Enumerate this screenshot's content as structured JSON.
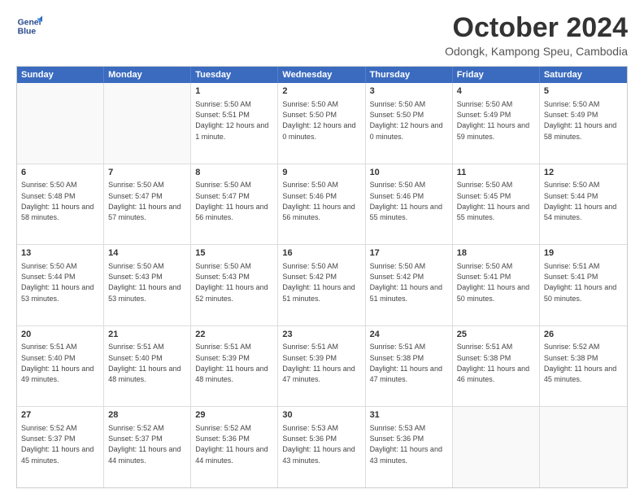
{
  "header": {
    "logo_line1": "General",
    "logo_line2": "Blue",
    "month_title": "October 2024",
    "location": "Odongk, Kampong Speu, Cambodia"
  },
  "days_of_week": [
    "Sunday",
    "Monday",
    "Tuesday",
    "Wednesday",
    "Thursday",
    "Friday",
    "Saturday"
  ],
  "weeks": [
    [
      {
        "day": "",
        "empty": true,
        "sunrise": "",
        "sunset": "",
        "daylight": ""
      },
      {
        "day": "",
        "empty": true,
        "sunrise": "",
        "sunset": "",
        "daylight": ""
      },
      {
        "day": "1",
        "sunrise": "Sunrise: 5:50 AM",
        "sunset": "Sunset: 5:51 PM",
        "daylight": "Daylight: 12 hours and 1 minute."
      },
      {
        "day": "2",
        "sunrise": "Sunrise: 5:50 AM",
        "sunset": "Sunset: 5:50 PM",
        "daylight": "Daylight: 12 hours and 0 minutes."
      },
      {
        "day": "3",
        "sunrise": "Sunrise: 5:50 AM",
        "sunset": "Sunset: 5:50 PM",
        "daylight": "Daylight: 12 hours and 0 minutes."
      },
      {
        "day": "4",
        "sunrise": "Sunrise: 5:50 AM",
        "sunset": "Sunset: 5:49 PM",
        "daylight": "Daylight: 11 hours and 59 minutes."
      },
      {
        "day": "5",
        "sunrise": "Sunrise: 5:50 AM",
        "sunset": "Sunset: 5:49 PM",
        "daylight": "Daylight: 11 hours and 58 minutes."
      }
    ],
    [
      {
        "day": "6",
        "sunrise": "Sunrise: 5:50 AM",
        "sunset": "Sunset: 5:48 PM",
        "daylight": "Daylight: 11 hours and 58 minutes."
      },
      {
        "day": "7",
        "sunrise": "Sunrise: 5:50 AM",
        "sunset": "Sunset: 5:47 PM",
        "daylight": "Daylight: 11 hours and 57 minutes."
      },
      {
        "day": "8",
        "sunrise": "Sunrise: 5:50 AM",
        "sunset": "Sunset: 5:47 PM",
        "daylight": "Daylight: 11 hours and 56 minutes."
      },
      {
        "day": "9",
        "sunrise": "Sunrise: 5:50 AM",
        "sunset": "Sunset: 5:46 PM",
        "daylight": "Daylight: 11 hours and 56 minutes."
      },
      {
        "day": "10",
        "sunrise": "Sunrise: 5:50 AM",
        "sunset": "Sunset: 5:46 PM",
        "daylight": "Daylight: 11 hours and 55 minutes."
      },
      {
        "day": "11",
        "sunrise": "Sunrise: 5:50 AM",
        "sunset": "Sunset: 5:45 PM",
        "daylight": "Daylight: 11 hours and 55 minutes."
      },
      {
        "day": "12",
        "sunrise": "Sunrise: 5:50 AM",
        "sunset": "Sunset: 5:44 PM",
        "daylight": "Daylight: 11 hours and 54 minutes."
      }
    ],
    [
      {
        "day": "13",
        "sunrise": "Sunrise: 5:50 AM",
        "sunset": "Sunset: 5:44 PM",
        "daylight": "Daylight: 11 hours and 53 minutes."
      },
      {
        "day": "14",
        "sunrise": "Sunrise: 5:50 AM",
        "sunset": "Sunset: 5:43 PM",
        "daylight": "Daylight: 11 hours and 53 minutes."
      },
      {
        "day": "15",
        "sunrise": "Sunrise: 5:50 AM",
        "sunset": "Sunset: 5:43 PM",
        "daylight": "Daylight: 11 hours and 52 minutes."
      },
      {
        "day": "16",
        "sunrise": "Sunrise: 5:50 AM",
        "sunset": "Sunset: 5:42 PM",
        "daylight": "Daylight: 11 hours and 51 minutes."
      },
      {
        "day": "17",
        "sunrise": "Sunrise: 5:50 AM",
        "sunset": "Sunset: 5:42 PM",
        "daylight": "Daylight: 11 hours and 51 minutes."
      },
      {
        "day": "18",
        "sunrise": "Sunrise: 5:50 AM",
        "sunset": "Sunset: 5:41 PM",
        "daylight": "Daylight: 11 hours and 50 minutes."
      },
      {
        "day": "19",
        "sunrise": "Sunrise: 5:51 AM",
        "sunset": "Sunset: 5:41 PM",
        "daylight": "Daylight: 11 hours and 50 minutes."
      }
    ],
    [
      {
        "day": "20",
        "sunrise": "Sunrise: 5:51 AM",
        "sunset": "Sunset: 5:40 PM",
        "daylight": "Daylight: 11 hours and 49 minutes."
      },
      {
        "day": "21",
        "sunrise": "Sunrise: 5:51 AM",
        "sunset": "Sunset: 5:40 PM",
        "daylight": "Daylight: 11 hours and 48 minutes."
      },
      {
        "day": "22",
        "sunrise": "Sunrise: 5:51 AM",
        "sunset": "Sunset: 5:39 PM",
        "daylight": "Daylight: 11 hours and 48 minutes."
      },
      {
        "day": "23",
        "sunrise": "Sunrise: 5:51 AM",
        "sunset": "Sunset: 5:39 PM",
        "daylight": "Daylight: 11 hours and 47 minutes."
      },
      {
        "day": "24",
        "sunrise": "Sunrise: 5:51 AM",
        "sunset": "Sunset: 5:38 PM",
        "daylight": "Daylight: 11 hours and 47 minutes."
      },
      {
        "day": "25",
        "sunrise": "Sunrise: 5:51 AM",
        "sunset": "Sunset: 5:38 PM",
        "daylight": "Daylight: 11 hours and 46 minutes."
      },
      {
        "day": "26",
        "sunrise": "Sunrise: 5:52 AM",
        "sunset": "Sunset: 5:38 PM",
        "daylight": "Daylight: 11 hours and 45 minutes."
      }
    ],
    [
      {
        "day": "27",
        "sunrise": "Sunrise: 5:52 AM",
        "sunset": "Sunset: 5:37 PM",
        "daylight": "Daylight: 11 hours and 45 minutes."
      },
      {
        "day": "28",
        "sunrise": "Sunrise: 5:52 AM",
        "sunset": "Sunset: 5:37 PM",
        "daylight": "Daylight: 11 hours and 44 minutes."
      },
      {
        "day": "29",
        "sunrise": "Sunrise: 5:52 AM",
        "sunset": "Sunset: 5:36 PM",
        "daylight": "Daylight: 11 hours and 44 minutes."
      },
      {
        "day": "30",
        "sunrise": "Sunrise: 5:53 AM",
        "sunset": "Sunset: 5:36 PM",
        "daylight": "Daylight: 11 hours and 43 minutes."
      },
      {
        "day": "31",
        "sunrise": "Sunrise: 5:53 AM",
        "sunset": "Sunset: 5:36 PM",
        "daylight": "Daylight: 11 hours and 43 minutes."
      },
      {
        "day": "",
        "empty": true,
        "sunrise": "",
        "sunset": "",
        "daylight": ""
      },
      {
        "day": "",
        "empty": true,
        "sunrise": "",
        "sunset": "",
        "daylight": ""
      }
    ]
  ]
}
